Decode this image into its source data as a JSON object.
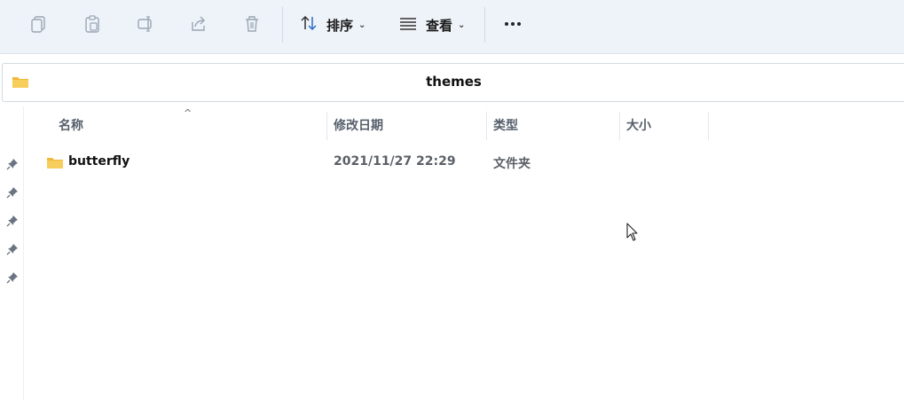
{
  "toolbar": {
    "icons": [
      "copy-icon",
      "paste-icon",
      "rename-icon",
      "share-icon",
      "delete-icon"
    ],
    "sort": {
      "label": "排序",
      "icon": "sort-arrows-icon"
    },
    "view": {
      "label": "查看",
      "icon": "view-lines-icon"
    },
    "more": {
      "icon": "more-dots-icon"
    }
  },
  "address": {
    "path": "themes",
    "icon": "folder-icon"
  },
  "columns": {
    "name": "名称",
    "modified": "修改日期",
    "type": "类型",
    "size": "大小"
  },
  "files": [
    {
      "name": "butterfly",
      "modified": "2021/11/27 22:29",
      "type": "文件夹",
      "size": ""
    }
  ],
  "colors": {
    "toolbar_bg": "#eef3f9",
    "folder_yellow": "#f5c24a",
    "accent_blue": "#2b6cc4"
  }
}
